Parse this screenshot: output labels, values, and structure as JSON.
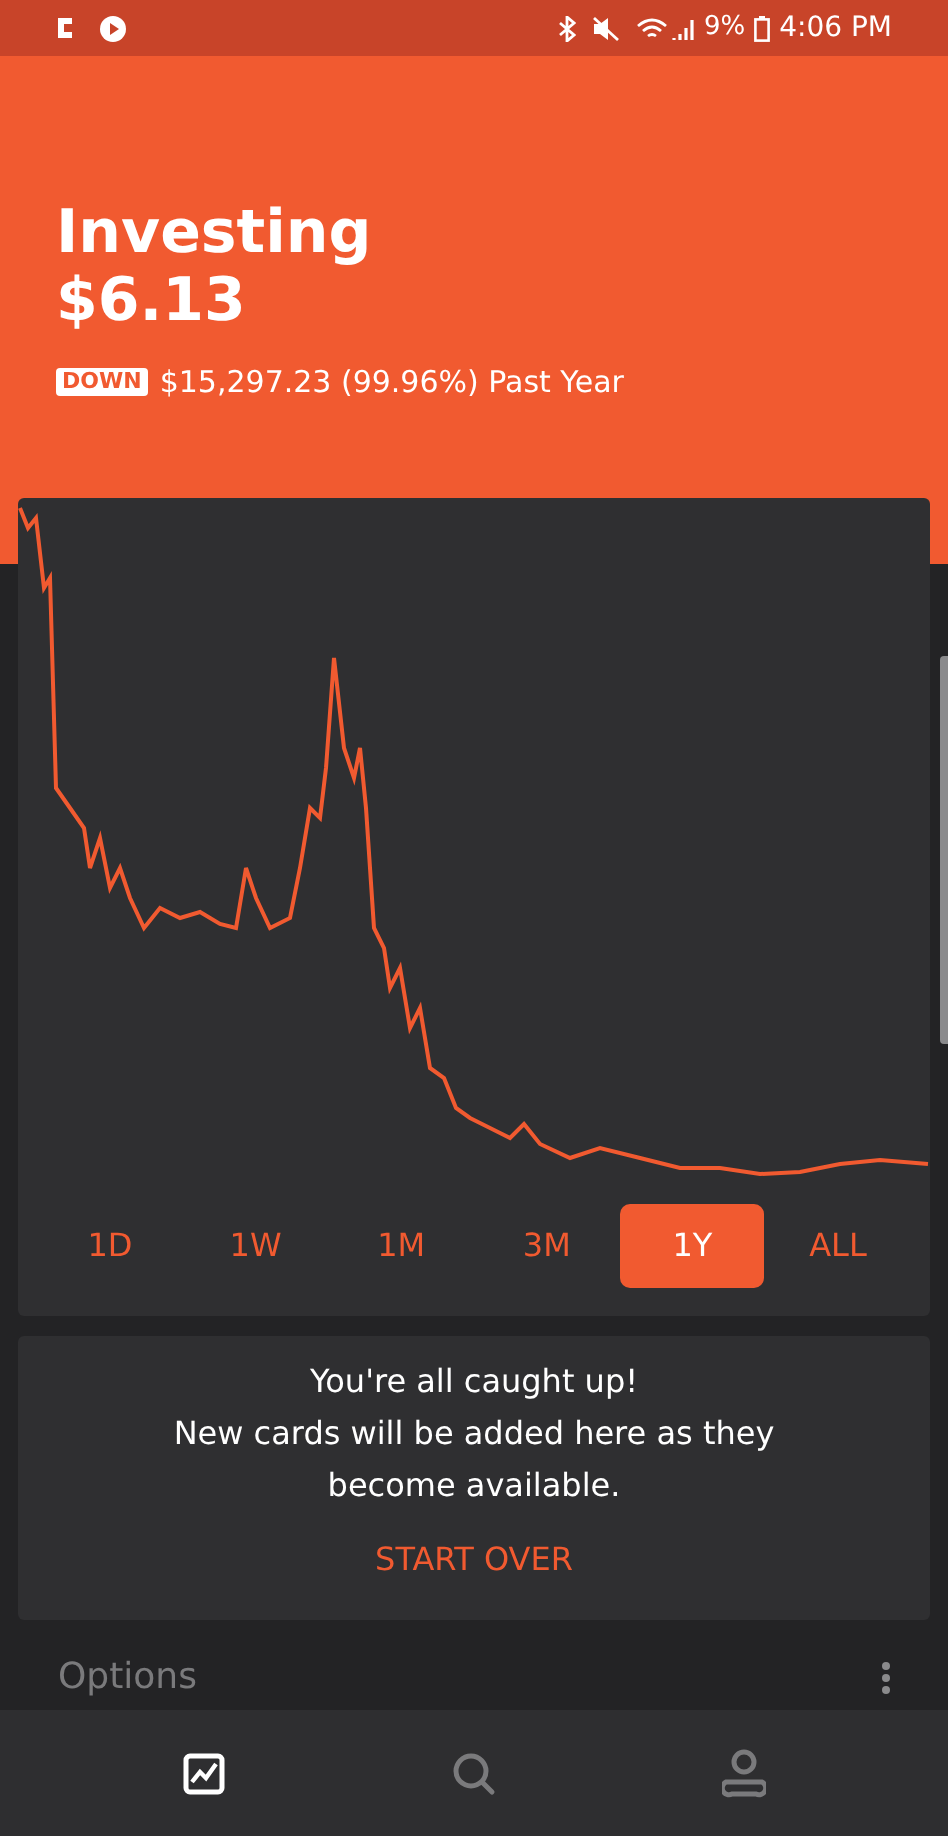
{
  "status_bar": {
    "battery": "9%",
    "time": "4:06 PM"
  },
  "header": {
    "title": "Investing",
    "value": "$6.13",
    "badge": "DOWN",
    "change": "$15,297.23 (99.96%) Past Year"
  },
  "ranges": [
    {
      "label": "1D",
      "selected": false
    },
    {
      "label": "1W",
      "selected": false
    },
    {
      "label": "1M",
      "selected": false
    },
    {
      "label": "3M",
      "selected": false
    },
    {
      "label": "1Y",
      "selected": true
    },
    {
      "label": "ALL",
      "selected": false
    }
  ],
  "cards": {
    "title": "You're all caught up!",
    "message": "New cards will be added here as they become available.",
    "action": "START OVER"
  },
  "section": {
    "title": "Options"
  },
  "nav": [
    {
      "kind": "chart",
      "selected": true
    },
    {
      "kind": "search",
      "selected": false
    },
    {
      "kind": "account",
      "selected": false
    }
  ]
}
